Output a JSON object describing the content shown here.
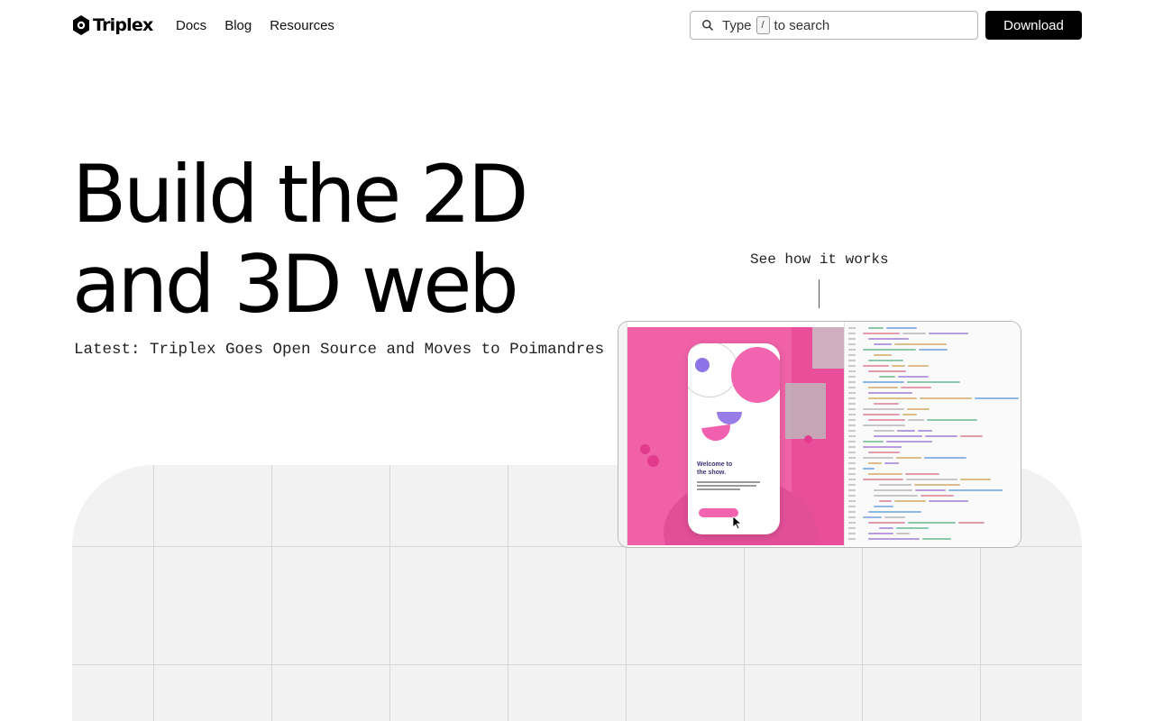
{
  "header": {
    "logo_text": "Triplex",
    "nav": [
      {
        "label": "Docs"
      },
      {
        "label": "Blog"
      },
      {
        "label": "Resources"
      }
    ],
    "search": {
      "prefix": "Type",
      "key": "/",
      "suffix": "to search"
    },
    "download_label": "Download"
  },
  "hero": {
    "title_line1": "Build the 2D",
    "title_line2": "and 3D web",
    "latest": "Latest: Triplex Goes Open Source and Moves to Poimandres",
    "see_how": "See how it works"
  },
  "video": {
    "welcome_text": "Welcome to\nthe show."
  },
  "colors": {
    "accent_pink": "#f061a8",
    "accent_purple": "#8d74e6",
    "panel_gray": "#f2f2f2"
  }
}
